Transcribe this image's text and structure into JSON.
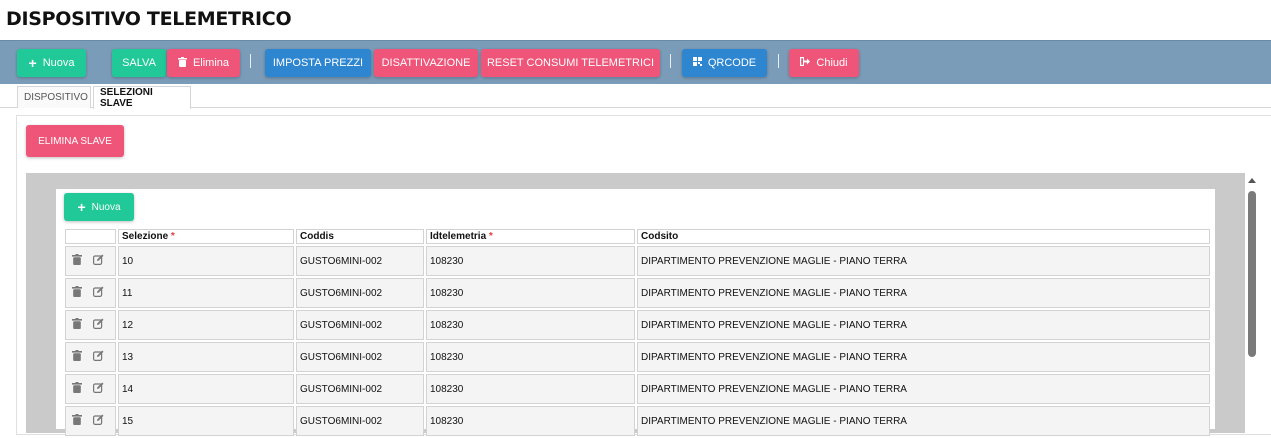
{
  "title": "DISPOSITIVO TELEMETRICO",
  "toolbar": {
    "nuova": "Nuova",
    "salva": "SALVA",
    "elimina": "Elimina",
    "imposta_prezzi": "IMPOSTA PREZZI",
    "disattivazione": "DISATTIVAZIONE",
    "reset": "RESET CONSUMI TELEMETRICI",
    "qrcode": "QRCODE",
    "chiudi": "Chiudi"
  },
  "tabs": [
    "DISPOSITIVO",
    "SELEZIONI SLAVE"
  ],
  "panel": {
    "elimina_slave": "ELIMINA SLAVE",
    "nuova": "Nuova"
  },
  "table": {
    "columns": [
      "Selezione",
      "Coddis",
      "Idtelemetria",
      "Codsito"
    ],
    "required_marker": "*",
    "rows": [
      [
        "10",
        "GUSTO6MINI-002",
        "108230",
        "DIPARTIMENTO PREVENZIONE MAGLIE - PIANO TERRA"
      ],
      [
        "11",
        "GUSTO6MINI-002",
        "108230",
        "DIPARTIMENTO PREVENZIONE MAGLIE - PIANO TERRA"
      ],
      [
        "12",
        "GUSTO6MINI-002",
        "108230",
        "DIPARTIMENTO PREVENZIONE MAGLIE - PIANO TERRA"
      ],
      [
        "13",
        "GUSTO6MINI-002",
        "108230",
        "DIPARTIMENTO PREVENZIONE MAGLIE - PIANO TERRA"
      ],
      [
        "14",
        "GUSTO6MINI-002",
        "108230",
        "DIPARTIMENTO PREVENZIONE MAGLIE - PIANO TERRA"
      ],
      [
        "15",
        "GUSTO6MINI-002",
        "108230",
        "DIPARTIMENTO PREVENZIONE MAGLIE - PIANO TERRA"
      ]
    ]
  },
  "colors": {
    "green": "#20c997",
    "red": "#ef5578",
    "blue": "#2e86d1",
    "toolbar": "#7b9cb8"
  }
}
